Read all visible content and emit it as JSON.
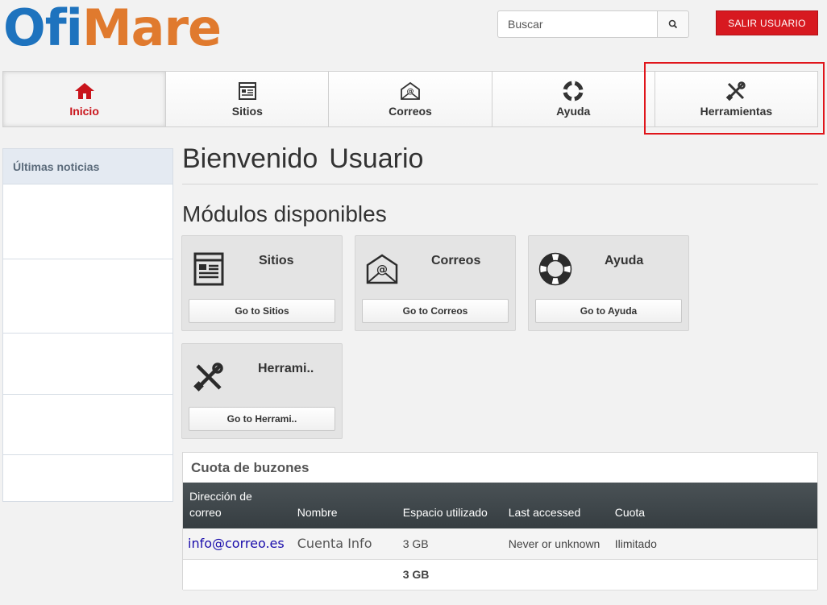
{
  "logo": {
    "part1": "Ofi",
    "part2": "Mare"
  },
  "search": {
    "placeholder": "Buscar",
    "icon": "search-icon"
  },
  "logout_label": "SALIR  USUARIO",
  "nav": [
    {
      "label": "Inicio",
      "icon": "home-icon"
    },
    {
      "label": "Sitios",
      "icon": "site-icon"
    },
    {
      "label": "Correos",
      "icon": "mail-icon"
    },
    {
      "label": "Ayuda",
      "icon": "lifebuoy-icon"
    },
    {
      "label": "Herramientas",
      "icon": "tools-icon"
    }
  ],
  "sidebar": {
    "title": "Últimas noticias"
  },
  "welcome": {
    "greeting": "Bienvenido",
    "user": "Usuario"
  },
  "modules_title": "Módulos disponibles",
  "modules": [
    {
      "title": "Sitios",
      "button": "Go to Sitios",
      "icon": "site-icon"
    },
    {
      "title": "Correos",
      "button": "Go to Correos",
      "icon": "mail-icon"
    },
    {
      "title": "Ayuda",
      "button": "Go to Ayuda",
      "icon": "lifebuoy-icon"
    },
    {
      "title": "Herrami..",
      "button": "Go to Herrami..",
      "icon": "tools-icon"
    }
  ],
  "quota": {
    "title": "Cuota de buzones",
    "headers": [
      "Dirección de correo",
      "Nombre",
      "Espacio utilizado",
      "Last accessed",
      "Cuota"
    ],
    "rows": [
      [
        "info@correo.es",
        "Cuenta Info",
        "3 GB",
        "Never or unknown",
        "Ilimitado"
      ]
    ],
    "total": "3 GB"
  },
  "colors": {
    "brand_blue": "#1e73be",
    "brand_orange": "#e07a2e",
    "danger": "#d71920",
    "active_nav": "#c9141b"
  }
}
